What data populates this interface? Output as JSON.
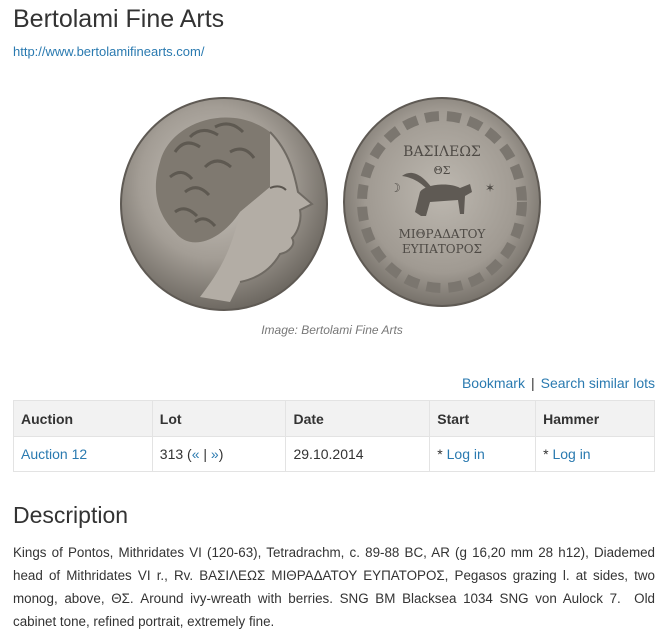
{
  "header": {
    "title": "Bertolami Fine Arts",
    "site_url": "http://www.bertolamifinearts.com/"
  },
  "image": {
    "caption": "Image: Bertolami Fine Arts",
    "obverse_legend": "",
    "reverse_legend_top": "ΒΑΣΙΛΕΩΣ",
    "reverse_legend_bottom_1": "ΜΙΘΡΑΔΑΤΟΥ",
    "reverse_legend_bottom_2": "ΕΥΠΑΤΟΡΟΣ",
    "reverse_field": "ΘΣ"
  },
  "actions": {
    "bookmark": "Bookmark",
    "separator": "|",
    "search_similar": "Search similar lots"
  },
  "table": {
    "headers": {
      "auction": "Auction",
      "lot": "Lot",
      "date": "Date",
      "start": "Start",
      "hammer": "Hammer"
    },
    "row": {
      "auction": "Auction 12",
      "lot_number": "313",
      "lot_open": " (",
      "prev": "«",
      "lot_sep": " | ",
      "next": "»",
      "lot_close": ")",
      "date": "29.10.2014",
      "start_prefix": "* ",
      "start_link": "Log in",
      "hammer_prefix": "* ",
      "hammer_link": "Log in"
    }
  },
  "description": {
    "title": "Description",
    "text": "Kings of Pontos, Mithridates VI (120-63), Tetradrachm, c. 89-88 BC, AR (g 16,20 mm 28 h12), Diademed head of Mithridates VI r., Rv. ΒΑΣΙΛΕΩΣ ΜΙΘΡΑΔΑΤΟΥ ΕΥΠΑΤΟΡΟΣ, Pegasos grazing l. at sides, two monog, above, ΘΣ. Around ivy-wreath with berries. SNG BM Blacksea 1034 SNG von Aulock 7. Old cabinet tone, refined portrait, extremely fine."
  },
  "colors": {
    "link": "#2a7ab0",
    "text": "#333333",
    "table_header_bg": "#f2f2f2",
    "border": "#e3e3e3",
    "coin_silver": "#a8a29a"
  }
}
